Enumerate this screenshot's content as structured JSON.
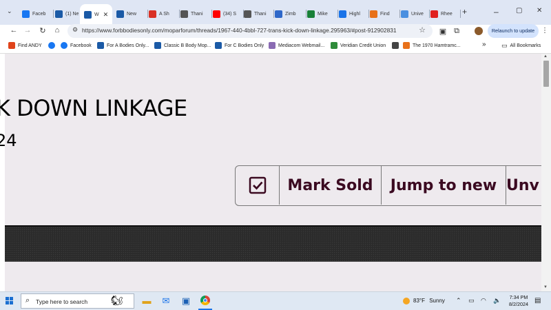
{
  "browser": {
    "tabs": [
      {
        "label": "Faceb",
        "icon": "facebook-icon",
        "color": "#1877f2"
      },
      {
        "label": "(1) Ne",
        "icon": "moparts-icon",
        "color": "#1b5aa6"
      },
      {
        "label": "W",
        "icon": "moparts-icon",
        "color": "#1b5aa6",
        "active": true
      },
      {
        "label": "New",
        "icon": "moparts-icon",
        "color": "#1b5aa6"
      },
      {
        "label": "A Sh",
        "icon": "gmail-icon",
        "color": "#d93025"
      },
      {
        "label": "Thani",
        "icon": "globe-icon",
        "color": "#555555"
      },
      {
        "label": "(34) S",
        "icon": "youtube-icon",
        "color": "#ff0000"
      },
      {
        "label": "Thani",
        "icon": "globe-icon",
        "color": "#555555"
      },
      {
        "label": "Zimb",
        "icon": "puzzle-app-icon",
        "color": "#2e67c9"
      },
      {
        "label": "Mike",
        "icon": "sheets-icon",
        "color": "#188038"
      },
      {
        "label": "Highl",
        "icon": "video-icon",
        "color": "#1a73e8"
      },
      {
        "label": "Find",
        "icon": "find-icon",
        "color": "#e8711a"
      },
      {
        "label": "Unive",
        "icon": "globe-icon",
        "color": "#4a8fe0"
      },
      {
        "label": "Rhee",
        "icon": "red-logo-icon",
        "color": "#e02020"
      }
    ],
    "new_tab": "+",
    "window_controls": [
      "–",
      "▢",
      "✕"
    ],
    "url": "https://www.forbbodiesonly.com/moparforum/threads/1967-440-4bbl-727-trans-kick-down-linkage.295963/#post-912902831",
    "relaunch_label": "Relaunch to update",
    "bookmarks": [
      {
        "label": "Find ANDY",
        "icon": "andy-icon",
        "color": "#e0441b"
      },
      {
        "label": "",
        "icon": "facebook-icon",
        "color": "#1877f2"
      },
      {
        "label": "Facebook",
        "icon": "facebook-icon",
        "color": "#1877f2"
      },
      {
        "label": "For A Bodies Only...",
        "icon": "moparts-icon",
        "color": "#1b5aa6"
      },
      {
        "label": "Classic B Body Mop...",
        "icon": "moparts-icon",
        "color": "#1b5aa6"
      },
      {
        "label": "For C Bodies Only",
        "icon": "moparts-icon",
        "color": "#1b5aa6"
      },
      {
        "label": "Mediacom Webmail...",
        "icon": "mediacom-icon",
        "color": "#8a6bb3"
      },
      {
        "label": "Veridian Credit Union",
        "icon": "veridian-icon",
        "color": "#2e8b3a"
      },
      {
        "label": "",
        "icon": "fs-icon",
        "color": "#444444"
      },
      {
        "label": "The 1970 Hamtramc...",
        "icon": "hamtramck-icon",
        "color": "#e8711a"
      }
    ],
    "bookmarks_overflow": "»",
    "all_bookmarks": "All Bookmarks"
  },
  "page": {
    "title_fragment": "K DOWN LINKAGE",
    "subtitle_fragment": "24",
    "actions": [
      {
        "label": "",
        "icon": "checkbox-icon"
      },
      {
        "label": "Mark Sold"
      },
      {
        "label": "Jump to new"
      },
      {
        "label": "Unv"
      }
    ],
    "accent_color": "#3b0a21"
  },
  "taskbar": {
    "search_placeholder": "Type here to search",
    "weather_temp": "83°F",
    "weather_text": "Sunny",
    "time": "7:34 PM",
    "date": "8/2/2024"
  }
}
